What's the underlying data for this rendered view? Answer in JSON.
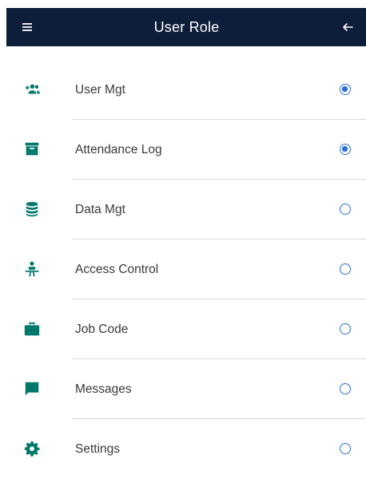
{
  "appbar": {
    "title": "User Role",
    "menu_icon": "hamburger-menu-icon",
    "back_icon": "arrow-back-icon",
    "background": "#0e1e3a"
  },
  "items": [
    {
      "label": "User Mgt",
      "icon": "add-group-icon",
      "selected": true
    },
    {
      "label": "Attendance Log",
      "icon": "archive-box-icon",
      "selected": true
    },
    {
      "label": "Data Mgt",
      "icon": "database-icon",
      "selected": false
    },
    {
      "label": "Access Control",
      "icon": "person-pass-icon",
      "selected": false
    },
    {
      "label": "Job Code",
      "icon": "briefcase-icon",
      "selected": false
    },
    {
      "label": "Messages",
      "icon": "message-icon",
      "selected": false
    },
    {
      "label": "Settings",
      "icon": "gear-icon",
      "selected": false
    }
  ],
  "colors": {
    "icon": "#00796b",
    "radio": "#2b6fd6",
    "divider": "#d8d8d8",
    "text": "#3a3a3a"
  }
}
